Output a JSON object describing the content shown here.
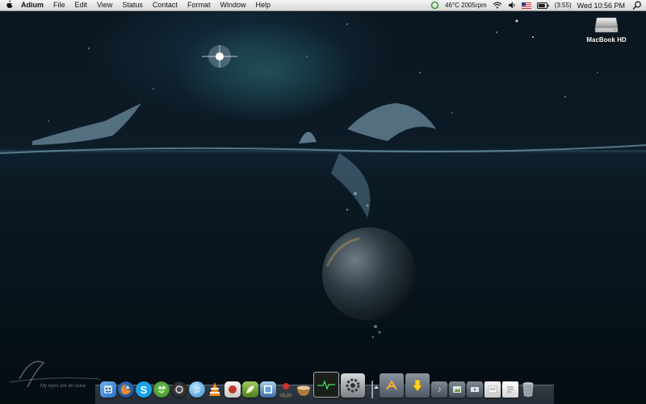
{
  "menubar": {
    "apple_icon": "apple-icon",
    "app_name": "Adium",
    "menus": [
      "File",
      "Edit",
      "View",
      "Status",
      "Contact",
      "Format",
      "Window",
      "Help"
    ],
    "status": {
      "temp_fan": "46°C 2005rpm",
      "battery_time": "(3:55)",
      "clock": "Wed 10:56 PM"
    }
  },
  "desktop": {
    "hd_label": "MacBook HD"
  },
  "watermark": {
    "tagline": "My eyes are an ocea"
  },
  "dock": {
    "apps": [
      {
        "name": "finder-icon",
        "color": "#3b82d6"
      },
      {
        "name": "firefox-icon",
        "color": "#e8712a"
      },
      {
        "name": "skype-icon",
        "color": "#1aa3e8"
      },
      {
        "name": "adium-icon",
        "color": "#4caf3a"
      },
      {
        "name": "quicktime-icon",
        "color": "#2a2a2a"
      },
      {
        "name": "itunes-icon",
        "color": "#3da2e0"
      },
      {
        "name": "vlc-icon",
        "color": "#f08a1c"
      },
      {
        "name": "app-icon-stamp",
        "color": "#c0392b"
      },
      {
        "name": "app-icon-leaf",
        "color": "#6a9a2a"
      },
      {
        "name": "preview-icon",
        "color": "#4a7bb0"
      },
      {
        "name": "joystick-icon",
        "color": "#d32f2f"
      },
      {
        "name": "app-icon-bowl",
        "color": "#a0703a"
      },
      {
        "name": "activity-monitor-icon",
        "color": "#1d2a1d"
      },
      {
        "name": "system-preferences-icon",
        "color": "#8a8f96"
      }
    ],
    "stacks": [
      {
        "name": "applications-folder-icon",
        "color": "#6a7480"
      },
      {
        "name": "downloads-folder-icon",
        "color": "#6a7480"
      },
      {
        "name": "music-folder-icon",
        "color": "#5f6a76"
      },
      {
        "name": "pictures-folder-icon",
        "color": "#5f6a76"
      },
      {
        "name": "movies-folder-icon",
        "color": "#5f6a76"
      },
      {
        "name": "documents-stack-icon",
        "color": "#d8d8d8"
      },
      {
        "name": "text-document-icon",
        "color": "#e6e6e6"
      },
      {
        "name": "trash-icon",
        "color": "#9aa2aa"
      }
    ]
  }
}
